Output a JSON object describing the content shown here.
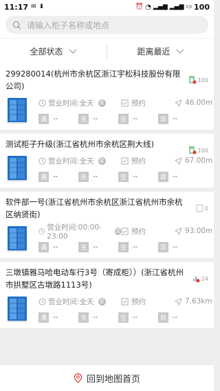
{
  "status_bar": {
    "time": "11:17",
    "battery": "100"
  },
  "search": {
    "placeholder": "请输入柜子名称或地点"
  },
  "filters": [
    {
      "label": "全部状态"
    },
    {
      "label": "距离最近"
    }
  ],
  "cards": [
    {
      "title": "299280014(杭州市余杭区浙江宇松科技股份有限公司)",
      "side_value": "100",
      "side_icon": "charging-offline-icon",
      "hours": "营业时间:全天",
      "hours_badge": "营",
      "reserve": "预约",
      "distance": "46.00m",
      "slots": [
        {
          "tag": "满",
          "value": "--"
        },
        {
          "tag": "充",
          "value": "--"
        },
        {
          "tag": "空",
          "value": "--"
        },
        {
          "tag": "异",
          "value": "--"
        }
      ]
    },
    {
      "title": "测试柜子升级(浙江省杭州市余杭区荆大线)",
      "side_value": "100",
      "side_icon": "charging-offline-icon",
      "hours": "营业时间:全天",
      "hours_badge": "营",
      "reserve": "预约",
      "distance": "67.00m",
      "slots": [
        {
          "tag": "满",
          "value": "--"
        },
        {
          "tag": "充",
          "value": "--"
        },
        {
          "tag": "空",
          "value": "--"
        },
        {
          "tag": "异",
          "value": "--"
        }
      ]
    },
    {
      "title": "软件部一号(浙江省杭州市余杭区浙江省杭州市余杭区纳贤街)",
      "side_value": "0",
      "side_icon": "empty-box-icon",
      "hours": "营业时间:00:00-23:00",
      "hours_badge": "营",
      "reserve": "预约",
      "distance": "93.00m",
      "slots": [
        {
          "tag": "满",
          "value": "--"
        },
        {
          "tag": "充",
          "value": "--"
        },
        {
          "tag": "空",
          "value": "--"
        },
        {
          "tag": "异",
          "value": "--"
        }
      ]
    },
    {
      "title": "三墩镇雅马哈电动车行3号（寄成柜））(浙江省杭州市拱墅区古墩路1113号)",
      "side_value": "24",
      "side_icon": "signal-offline-icon",
      "hours": "营业时间:全天",
      "hours_badge": "营",
      "reserve": "预约",
      "distance": "7.63km",
      "slots": [
        {
          "tag": "满",
          "value": "--"
        },
        {
          "tag": "充",
          "value": "--"
        },
        {
          "tag": "空",
          "value": "--"
        },
        {
          "tag": "异",
          "value": "--"
        }
      ]
    }
  ],
  "bottom": {
    "label": "回到地图首页"
  },
  "colors": {
    "accent": "#2e9b3e",
    "error": "#e53935",
    "tag_gray": "#c8c8c8",
    "cabinet_blue": "#1e6fc8"
  }
}
